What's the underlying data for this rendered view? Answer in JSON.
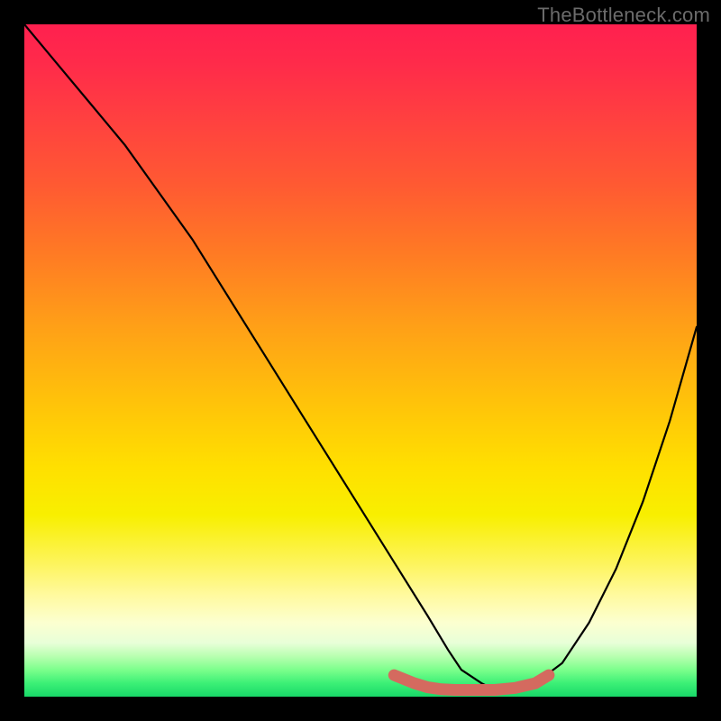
{
  "watermark": "TheBottleneck.com",
  "chart_data": {
    "type": "line",
    "title": "",
    "xlabel": "",
    "ylabel": "",
    "xlim": [
      0,
      100
    ],
    "ylim": [
      0,
      100
    ],
    "series": [
      {
        "name": "black-curve",
        "color": "#000000",
        "x": [
          0,
          5,
          10,
          15,
          20,
          25,
          30,
          35,
          40,
          45,
          50,
          55,
          60,
          63,
          65,
          68,
          70,
          73,
          76,
          80,
          84,
          88,
          92,
          96,
          100
        ],
        "y": [
          100,
          94,
          88,
          82,
          75,
          68,
          60,
          52,
          44,
          36,
          28,
          20,
          12,
          7,
          4,
          2,
          1,
          1,
          2,
          5,
          11,
          19,
          29,
          41,
          55
        ]
      },
      {
        "name": "red-band-bottom",
        "color": "#d46a5f",
        "x": [
          55,
          58,
          60,
          62,
          64,
          67,
          70,
          73,
          76,
          78
        ],
        "y": [
          3.2,
          2.0,
          1.4,
          1.1,
          1.0,
          1.0,
          1.0,
          1.3,
          2.0,
          3.2
        ]
      }
    ],
    "background_gradient_stops": [
      {
        "pos": 0.0,
        "color": "#ff204f"
      },
      {
        "pos": 0.14,
        "color": "#ff4040"
      },
      {
        "pos": 0.34,
        "color": "#ff7a24"
      },
      {
        "pos": 0.56,
        "color": "#ffc20a"
      },
      {
        "pos": 0.73,
        "color": "#f8ef00"
      },
      {
        "pos": 0.89,
        "color": "#fcffd0"
      },
      {
        "pos": 1.0,
        "color": "#18d868"
      }
    ]
  }
}
